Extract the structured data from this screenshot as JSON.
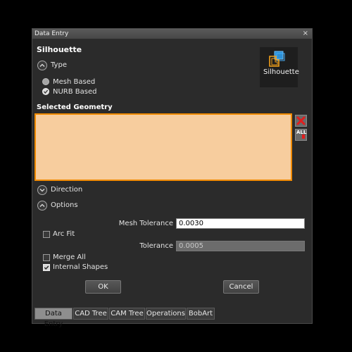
{
  "window": {
    "title": "Data Entry",
    "close_glyph": "×"
  },
  "header": {
    "title": "Silhouette",
    "icon_name": "silhouette-icon",
    "icon_caption": "Silhouette"
  },
  "type_section": {
    "label": "Type",
    "options": [
      {
        "label": "Mesh Based",
        "selected": false
      },
      {
        "label": "NURB Based",
        "selected": true
      }
    ]
  },
  "geometry": {
    "label": "Selected Geometry",
    "remove_icon": "red-x-icon",
    "all_icon": "all-select-icon",
    "all_text": "ALL",
    "list_color": "#f7cd9e",
    "border_color": "#f08a00"
  },
  "direction_section": {
    "label": "Direction"
  },
  "options_section": {
    "label": "Options",
    "mesh_tolerance_label": "Mesh Tolerance",
    "mesh_tolerance_value": "0.0030",
    "arc_fit_label": "Arc Fit",
    "arc_fit_checked": false,
    "tolerance_label": "Tolerance",
    "tolerance_value": "0.0005",
    "merge_all_label": "Merge All",
    "merge_all_checked": false,
    "internal_shapes_label": "Internal Shapes",
    "internal_shapes_checked": true
  },
  "buttons": {
    "ok": "OK",
    "cancel": "Cancel"
  },
  "tabs": [
    {
      "label": "Data Entry",
      "active": true
    },
    {
      "label": "CAD Tree",
      "active": false
    },
    {
      "label": "CAM Tree",
      "active": false
    },
    {
      "label": "Operations",
      "active": false
    },
    {
      "label": "BobArt",
      "active": false
    }
  ]
}
